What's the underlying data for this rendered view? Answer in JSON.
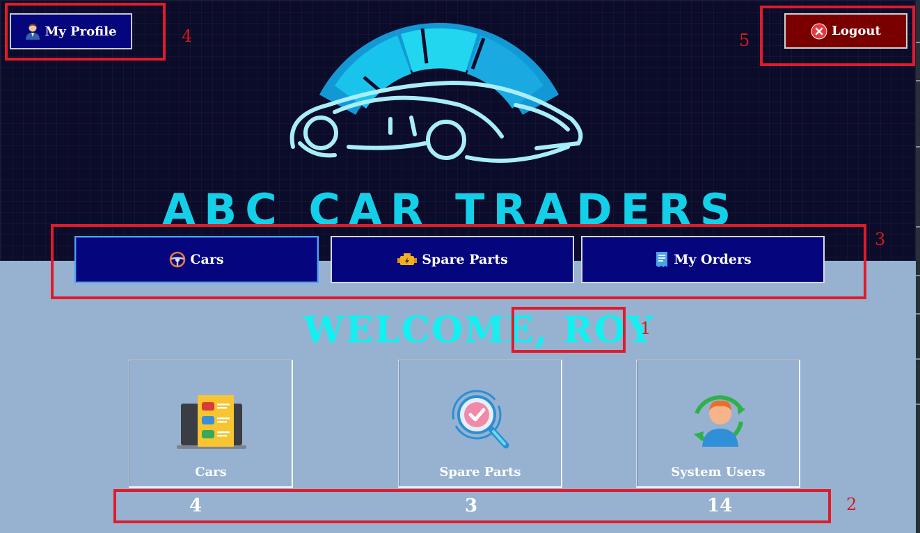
{
  "header": {
    "profile_label": "My Profile",
    "logout_label": "Logout",
    "brand": "ABC CAR TRADERS"
  },
  "nav": [
    {
      "label": "Cars",
      "icon": "steering-wheel-icon",
      "active": true
    },
    {
      "label": "Spare Parts",
      "icon": "engine-icon",
      "active": false
    },
    {
      "label": "My Orders",
      "icon": "receipt-icon",
      "active": false
    }
  ],
  "welcome": {
    "prefix": "WELCOME, ",
    "user": "ROY"
  },
  "stats": [
    {
      "label": "Cars",
      "count": "4",
      "icon": "car-list-icon"
    },
    {
      "label": "Spare Parts",
      "count": "3",
      "icon": "search-check-icon"
    },
    {
      "label": "System Users",
      "count": "14",
      "icon": "user-refresh-icon"
    }
  ],
  "annotations": [
    "1",
    "2",
    "3",
    "4",
    "5"
  ],
  "colors": {
    "header_bg": "#0b0b2a",
    "page_bg": "#97b2d0",
    "nav_bg": "#05057e",
    "logout_bg": "#7a0000",
    "welcome": "#13f0f2",
    "annotation": "#e01b2a"
  }
}
